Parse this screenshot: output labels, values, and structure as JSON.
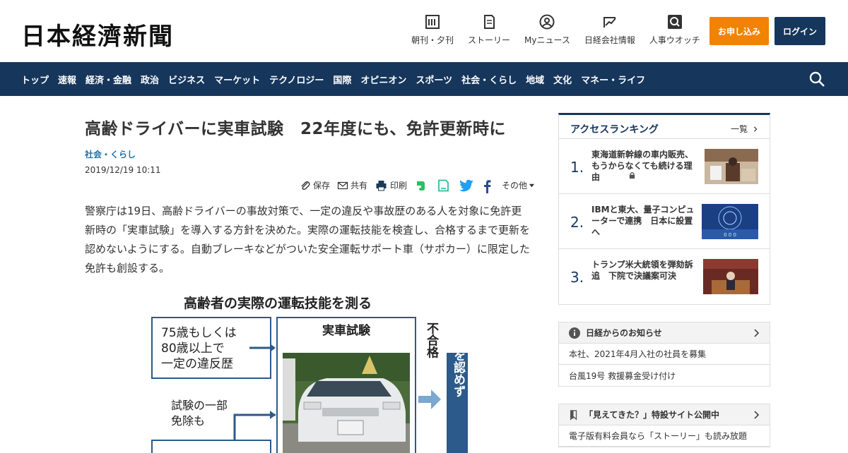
{
  "header": {
    "logo": "日本経濟新聞",
    "nav": [
      {
        "label": "朝刊・夕刊",
        "icon": "newspaper-icon"
      },
      {
        "label": "ストーリー",
        "icon": "story-icon"
      },
      {
        "label": "Myニュース",
        "icon": "user-icon"
      },
      {
        "label": "日経会社情報",
        "icon": "chart-icon"
      },
      {
        "label": "人事ウオッチ",
        "icon": "search-person-icon"
      }
    ],
    "apply_label": "お申し込み",
    "login_label": "ログイン"
  },
  "category_nav": [
    "トップ",
    "速報",
    "経済・金融",
    "政治",
    "ビジネス",
    "マーケット",
    "テクノロジー",
    "国際",
    "オピニオン",
    "スポーツ",
    "社会・くらし",
    "地域",
    "文化",
    "マネー・ライフ"
  ],
  "article": {
    "title": "高齢ドライバーに実車試験　22年度にも、免許更新時に",
    "category": "社会・くらし",
    "date": "2019/12/19 10:11",
    "tools": {
      "save": "保存",
      "share": "共有",
      "print": "印刷",
      "other": "その他"
    },
    "body": "警察庁は19日、高齢ドライバーの事故対策で、一定の違反や事故歴のある人を対象に免許更新時の「実車試験」を導入する方針を決めた。実際の運転技能を検査し、合格するまで更新を認めないようにする。自動ブレーキなどがついた安全運転サポート車（サポカー）に限定した免許も創設する。",
    "figure": {
      "title": "高齢者の実際の運転技能を測る",
      "box1": [
        "75歳もしくは",
        "80歳以上で",
        "一定の違反歴"
      ],
      "box2": "実車試験",
      "note": [
        "試験の一部",
        "免除も"
      ],
      "fail": "不合格",
      "result": "運転を認めず"
    }
  },
  "sidebar": {
    "ranking": {
      "title": "アクセスランキング",
      "more": "一覧",
      "items": [
        {
          "rank": "1.",
          "text": "東海道新幹線の車内販売、もうからなくても続ける理由"
        },
        {
          "rank": "2.",
          "text": "IBMと東大、量子コンピューターで連携　日本に設置へ"
        },
        {
          "rank": "3.",
          "text": "トランプ米大統領を弾劾訴追　下院で決議案可決"
        }
      ]
    },
    "notice": {
      "title": "日経からのお知らせ",
      "items": [
        "本社、2021年4月入社の社員を募集",
        "台風19号 救援募金受け付け"
      ]
    },
    "special": {
      "title": "「見えてきた？」特設サイト公開中",
      "items": [
        "電子版有料会員なら「ストーリー」も読み放題"
      ]
    }
  },
  "colors": {
    "navy": "#16365c",
    "orange": "#f08300",
    "link": "#1d6ea8"
  }
}
